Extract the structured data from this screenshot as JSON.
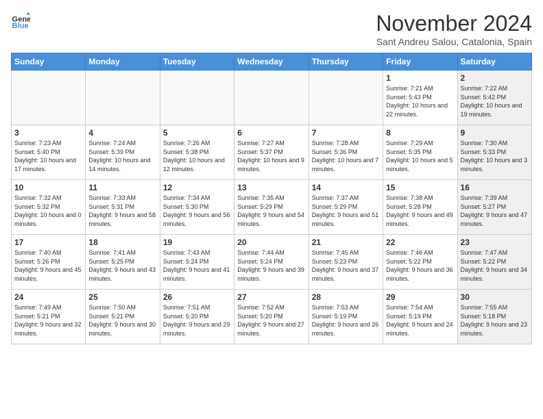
{
  "header": {
    "logo_line1": "General",
    "logo_line2": "Blue",
    "title": "November 2024",
    "subtitle": "Sant Andreu Salou, Catalonia, Spain"
  },
  "weekdays": [
    "Sunday",
    "Monday",
    "Tuesday",
    "Wednesday",
    "Thursday",
    "Friday",
    "Saturday"
  ],
  "weeks": [
    [
      {
        "day": "",
        "info": "",
        "empty": true
      },
      {
        "day": "",
        "info": "",
        "empty": true
      },
      {
        "day": "",
        "info": "",
        "empty": true
      },
      {
        "day": "",
        "info": "",
        "empty": true
      },
      {
        "day": "",
        "info": "",
        "empty": true
      },
      {
        "day": "1",
        "info": "Sunrise: 7:21 AM\nSunset: 5:43 PM\nDaylight: 10 hours and 22 minutes.",
        "empty": false,
        "shaded": false
      },
      {
        "day": "2",
        "info": "Sunrise: 7:22 AM\nSunset: 5:42 PM\nDaylight: 10 hours and 19 minutes.",
        "empty": false,
        "shaded": true
      }
    ],
    [
      {
        "day": "3",
        "info": "Sunrise: 7:23 AM\nSunset: 5:40 PM\nDaylight: 10 hours and 17 minutes.",
        "empty": false,
        "shaded": false
      },
      {
        "day": "4",
        "info": "Sunrise: 7:24 AM\nSunset: 5:39 PM\nDaylight: 10 hours and 14 minutes.",
        "empty": false,
        "shaded": false
      },
      {
        "day": "5",
        "info": "Sunrise: 7:26 AM\nSunset: 5:38 PM\nDaylight: 10 hours and 12 minutes.",
        "empty": false,
        "shaded": false
      },
      {
        "day": "6",
        "info": "Sunrise: 7:27 AM\nSunset: 5:37 PM\nDaylight: 10 hours and 9 minutes.",
        "empty": false,
        "shaded": false
      },
      {
        "day": "7",
        "info": "Sunrise: 7:28 AM\nSunset: 5:36 PM\nDaylight: 10 hours and 7 minutes.",
        "empty": false,
        "shaded": false
      },
      {
        "day": "8",
        "info": "Sunrise: 7:29 AM\nSunset: 5:35 PM\nDaylight: 10 hours and 5 minutes.",
        "empty": false,
        "shaded": false
      },
      {
        "day": "9",
        "info": "Sunrise: 7:30 AM\nSunset: 5:33 PM\nDaylight: 10 hours and 3 minutes.",
        "empty": false,
        "shaded": true
      }
    ],
    [
      {
        "day": "10",
        "info": "Sunrise: 7:32 AM\nSunset: 5:32 PM\nDaylight: 10 hours and 0 minutes.",
        "empty": false,
        "shaded": false
      },
      {
        "day": "11",
        "info": "Sunrise: 7:33 AM\nSunset: 5:31 PM\nDaylight: 9 hours and 58 minutes.",
        "empty": false,
        "shaded": false
      },
      {
        "day": "12",
        "info": "Sunrise: 7:34 AM\nSunset: 5:30 PM\nDaylight: 9 hours and 56 minutes.",
        "empty": false,
        "shaded": false
      },
      {
        "day": "13",
        "info": "Sunrise: 7:35 AM\nSunset: 5:29 PM\nDaylight: 9 hours and 54 minutes.",
        "empty": false,
        "shaded": false
      },
      {
        "day": "14",
        "info": "Sunrise: 7:37 AM\nSunset: 5:29 PM\nDaylight: 9 hours and 51 minutes.",
        "empty": false,
        "shaded": false
      },
      {
        "day": "15",
        "info": "Sunrise: 7:38 AM\nSunset: 5:28 PM\nDaylight: 9 hours and 49 minutes.",
        "empty": false,
        "shaded": false
      },
      {
        "day": "16",
        "info": "Sunrise: 7:39 AM\nSunset: 5:27 PM\nDaylight: 9 hours and 47 minutes.",
        "empty": false,
        "shaded": true
      }
    ],
    [
      {
        "day": "17",
        "info": "Sunrise: 7:40 AM\nSunset: 5:26 PM\nDaylight: 9 hours and 45 minutes.",
        "empty": false,
        "shaded": false
      },
      {
        "day": "18",
        "info": "Sunrise: 7:41 AM\nSunset: 5:25 PM\nDaylight: 9 hours and 43 minutes.",
        "empty": false,
        "shaded": false
      },
      {
        "day": "19",
        "info": "Sunrise: 7:43 AM\nSunset: 5:24 PM\nDaylight: 9 hours and 41 minutes.",
        "empty": false,
        "shaded": false
      },
      {
        "day": "20",
        "info": "Sunrise: 7:44 AM\nSunset: 5:24 PM\nDaylight: 9 hours and 39 minutes.",
        "empty": false,
        "shaded": false
      },
      {
        "day": "21",
        "info": "Sunrise: 7:45 AM\nSunset: 5:23 PM\nDaylight: 9 hours and 37 minutes.",
        "empty": false,
        "shaded": false
      },
      {
        "day": "22",
        "info": "Sunrise: 7:46 AM\nSunset: 5:22 PM\nDaylight: 9 hours and 36 minutes.",
        "empty": false,
        "shaded": false
      },
      {
        "day": "23",
        "info": "Sunrise: 7:47 AM\nSunset: 5:22 PM\nDaylight: 9 hours and 34 minutes.",
        "empty": false,
        "shaded": true
      }
    ],
    [
      {
        "day": "24",
        "info": "Sunrise: 7:49 AM\nSunset: 5:21 PM\nDaylight: 9 hours and 32 minutes.",
        "empty": false,
        "shaded": false
      },
      {
        "day": "25",
        "info": "Sunrise: 7:50 AM\nSunset: 5:21 PM\nDaylight: 9 hours and 30 minutes.",
        "empty": false,
        "shaded": false
      },
      {
        "day": "26",
        "info": "Sunrise: 7:51 AM\nSunset: 5:20 PM\nDaylight: 9 hours and 29 minutes.",
        "empty": false,
        "shaded": false
      },
      {
        "day": "27",
        "info": "Sunrise: 7:52 AM\nSunset: 5:20 PM\nDaylight: 9 hours and 27 minutes.",
        "empty": false,
        "shaded": false
      },
      {
        "day": "28",
        "info": "Sunrise: 7:53 AM\nSunset: 5:19 PM\nDaylight: 9 hours and 26 minutes.",
        "empty": false,
        "shaded": false
      },
      {
        "day": "29",
        "info": "Sunrise: 7:54 AM\nSunset: 5:19 PM\nDaylight: 9 hours and 24 minutes.",
        "empty": false,
        "shaded": false
      },
      {
        "day": "30",
        "info": "Sunrise: 7:55 AM\nSunset: 5:18 PM\nDaylight: 9 hours and 23 minutes.",
        "empty": false,
        "shaded": true
      }
    ]
  ]
}
